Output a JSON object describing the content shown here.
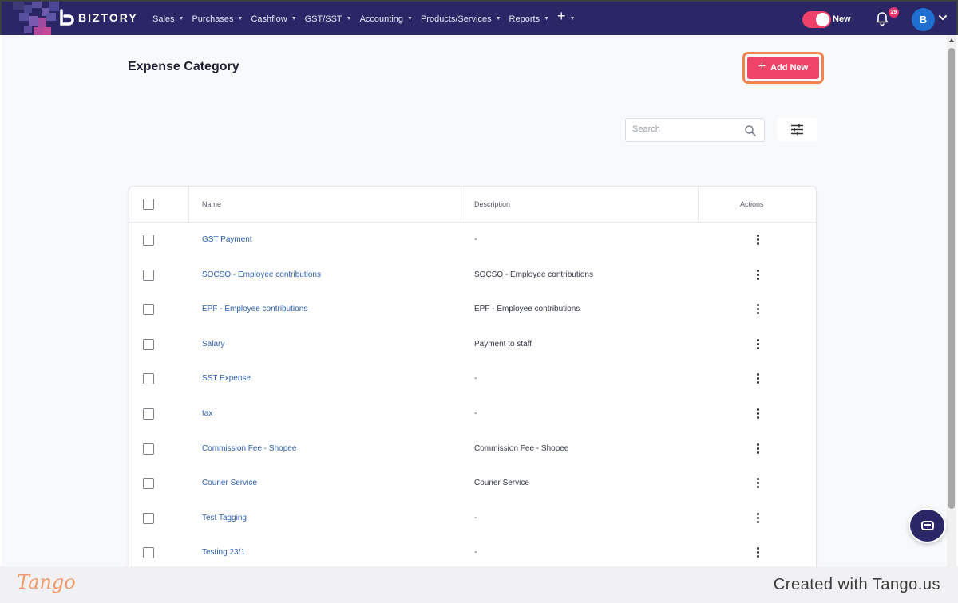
{
  "nav": {
    "brand": "BIZTORY",
    "menu": [
      {
        "label": "Sales"
      },
      {
        "label": "Purchases"
      },
      {
        "label": "Cashflow"
      },
      {
        "label": "GST/SST"
      },
      {
        "label": "Accounting"
      },
      {
        "label": "Products/Services"
      },
      {
        "label": "Reports"
      }
    ],
    "toggle_label": "New",
    "notification_count": "29",
    "avatar_initial": "B",
    "colors": {
      "bar": "#2b2666",
      "toggle": "#f0416a",
      "avatar": "#1e6fd0"
    }
  },
  "page": {
    "title": "Expense Category",
    "add_button_label": "Add New",
    "search_placeholder": "Search"
  },
  "table": {
    "columns": {
      "name": "Name",
      "description": "Description",
      "actions": "Actions"
    },
    "rows": [
      {
        "name": "GST Payment",
        "description": "-"
      },
      {
        "name": "SOCSO - Employee contributions",
        "description": "SOCSO - Employee contributions"
      },
      {
        "name": "EPF - Employee contributions",
        "description": "EPF - Employee contributions"
      },
      {
        "name": "Salary",
        "description": "Payment to staff"
      },
      {
        "name": "SST Expense",
        "description": "-"
      },
      {
        "name": "tax",
        "description": "-"
      },
      {
        "name": "Commission Fee - Shopee",
        "description": "Commission Fee - Shopee"
      },
      {
        "name": "Courier Service",
        "description": "Courier Service"
      },
      {
        "name": "Test Tagging",
        "description": "-"
      },
      {
        "name": "Testing 23/1",
        "description": "-"
      }
    ]
  },
  "footer": {
    "logo_text": "Tango",
    "credit": "Created with Tango.us"
  }
}
